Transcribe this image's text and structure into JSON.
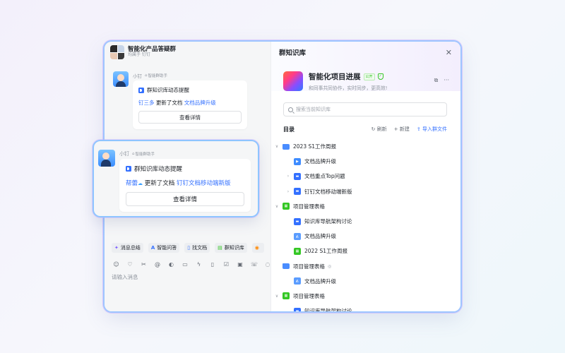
{
  "chat": {
    "title": "智能化产品答疑群",
    "subtitle": "均属于 钉钉",
    "message": {
      "sender": "小钉",
      "helper_badge": "智能群助手",
      "card_title": "群知识库动态提醒",
      "actor": "钉三多",
      "action": "更新了文档",
      "doc": "文档品牌升级",
      "button": "查看详情"
    },
    "chips": [
      {
        "icon": "✦",
        "label": "消息总结"
      },
      {
        "icon": "A",
        "label": "智能问答"
      },
      {
        "icon": "▯",
        "label": "找文档"
      },
      {
        "icon": "▤",
        "label": "群知识库"
      },
      {
        "icon": "◉",
        "label": ""
      }
    ],
    "input_placeholder": "请输入消息"
  },
  "popup": {
    "sender": "小钉",
    "helper_badge": "智能群助手",
    "card_title": "群知识库动态提醒",
    "actor": "帮蕾",
    "action": "更新了文档",
    "doc": "钉钉文档移动端新版",
    "button": "查看详情"
  },
  "panel": {
    "title": "群知识库",
    "kb_name": "智能化项目进展",
    "public_badge": "公开",
    "kb_desc": "和同事共同协作，实时同步，更高效!",
    "search_placeholder": "搜索当前知识库",
    "dir_title": "目录",
    "refresh": "刷新",
    "new": "新建",
    "import": "导入群文件",
    "tree": [
      {
        "label": "2023 S1工作周报",
        "icon": "folder",
        "caret": "∨",
        "indent": 0
      },
      {
        "label": "文档品牌升级",
        "icon": "video",
        "caret": "",
        "indent": 1
      },
      {
        "label": "文档重点Top问题",
        "icon": "doc",
        "caret": "›",
        "indent": 1
      },
      {
        "label": "钉钉文档移动端新版",
        "icon": "doc",
        "caret": "›",
        "indent": 1
      },
      {
        "label": "项目管理表格",
        "icon": "sheet",
        "caret": "∨",
        "indent": 0
      },
      {
        "label": "知识库导航架构讨论",
        "icon": "doc",
        "caret": "",
        "indent": 1
      },
      {
        "label": "文档品牌升级",
        "icon": "mind",
        "caret": "",
        "indent": 1
      },
      {
        "label": "2022 S1工作周报",
        "icon": "sheet",
        "caret": "",
        "indent": 1
      },
      {
        "label": "项目管理表格",
        "icon": "folder",
        "caret": "",
        "indent": 0,
        "eye": true
      },
      {
        "label": "文档品牌升级",
        "icon": "mind",
        "caret": "",
        "indent": 1
      },
      {
        "label": "项目管理表格",
        "icon": "sheet",
        "caret": "∨",
        "indent": 0
      },
      {
        "label": "知识库导航架构讨论",
        "icon": "doc",
        "caret": "",
        "indent": 1
      }
    ]
  }
}
